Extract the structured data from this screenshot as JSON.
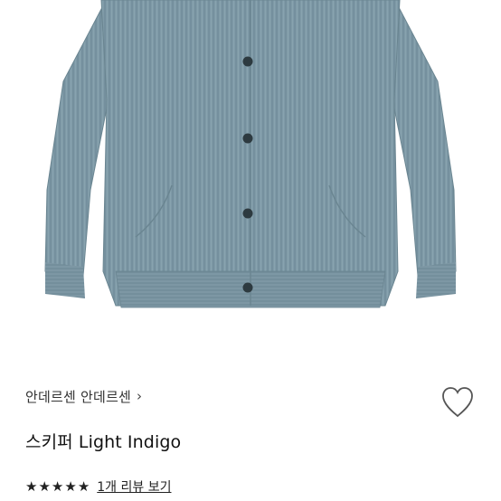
{
  "product": {
    "brand": "안데르센 안데르센",
    "name": "스키퍼 Light Indigo",
    "rating": 5,
    "review_link_text": "1개 리뷰 보기"
  },
  "icons": {
    "brand_chevron": "chevron-right-icon",
    "wishlist": "heart-outline-icon",
    "star": "star-filled-icon"
  },
  "colors": {
    "knit": "#7f9aa7",
    "button": "#2d3a40",
    "text": "#111111"
  }
}
